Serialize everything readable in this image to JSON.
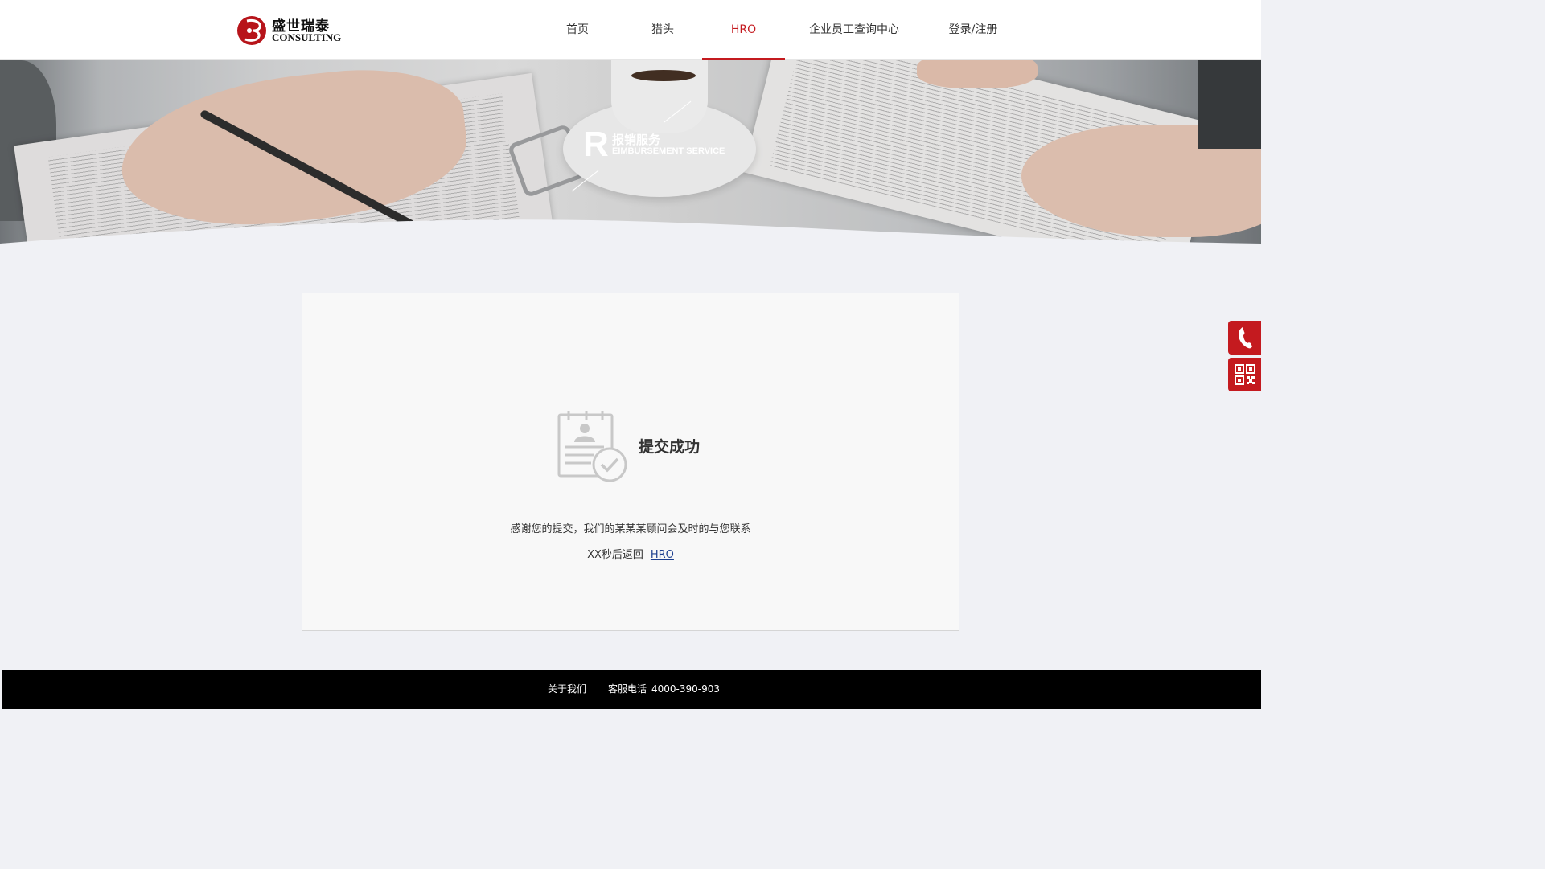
{
  "header": {
    "logo_cn": "盛世瑞泰",
    "logo_en": "CONSULTING",
    "nav": [
      {
        "label": "首页"
      },
      {
        "label": "猎头"
      },
      {
        "label": "HRO",
        "active": true
      },
      {
        "label": "企业员工查询中心"
      },
      {
        "label": "登录/注册"
      }
    ]
  },
  "banner": {
    "letter": "R",
    "title_cn": "报销服务",
    "title_en": "EIMBURSEMENT SERVICE"
  },
  "result": {
    "icon": "clipboard-check-icon",
    "title": "提交成功",
    "message": "感谢您的提交，我们的某某某顾问会及时的与您联系",
    "return_text": "XX秒后返回",
    "return_link": "HRO"
  },
  "side": {
    "phone_icon": "phone-icon",
    "qr_icon": "qr-code-icon"
  },
  "footer": {
    "about": "关于我们",
    "phone_label": "客服电话",
    "phone_number": "4000-390-903"
  },
  "colors": {
    "accent": "#c41a1f",
    "link": "#1d3f8f",
    "footer_bg": "#000000",
    "page_bg": "#f0f1f5"
  }
}
